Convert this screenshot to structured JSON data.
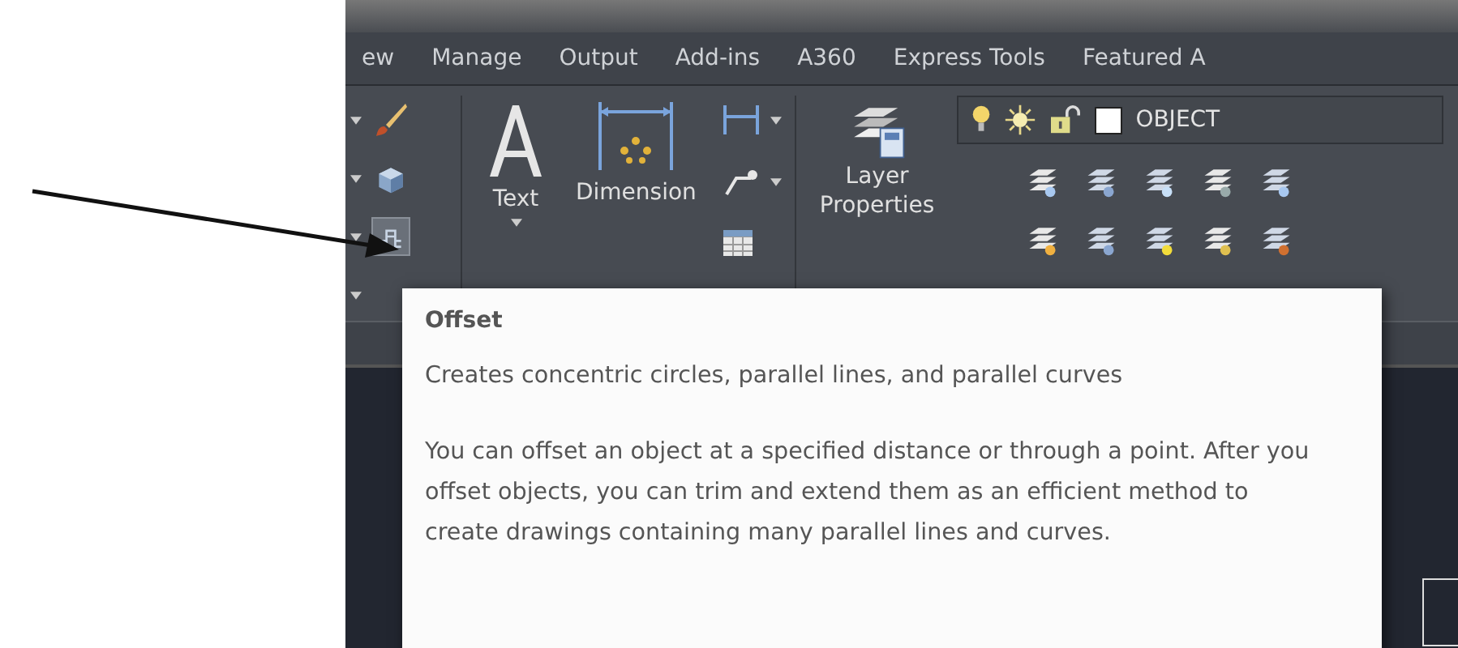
{
  "tabs": [
    {
      "label": "ew",
      "selected": false
    },
    {
      "label": "Manage",
      "selected": false
    },
    {
      "label": "Output",
      "selected": false
    },
    {
      "label": "Add-ins",
      "selected": false
    },
    {
      "label": "A360",
      "selected": false
    },
    {
      "label": "Express Tools",
      "selected": false
    },
    {
      "label": "Featured A",
      "selected": false
    }
  ],
  "ribbon": {
    "offset_button": {
      "hovered": true
    },
    "text_tool": {
      "label": "Text"
    },
    "dimension_tool": {
      "label": "Dimension"
    },
    "layer_properties": {
      "lines": [
        "Layer",
        "Properties"
      ]
    },
    "layer_control": {
      "name": "OBJECT"
    }
  },
  "tooltip": {
    "title": "Offset",
    "summary": "Creates concentric circles, parallel lines, and parallel curves",
    "description": "You can offset an object at a specified distance or through a point. After you offset objects, you can trim and extend them as an efficient method to create drawings containing many parallel lines and curves."
  }
}
